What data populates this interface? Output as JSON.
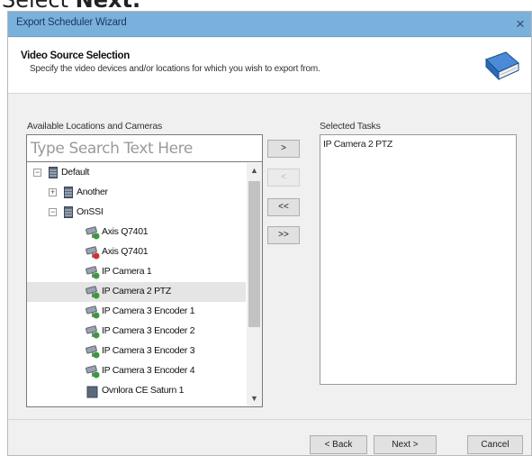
{
  "caption": {
    "prefix": "Select ",
    "bold": "Next."
  },
  "window": {
    "title": "Export Scheduler Wizard",
    "close_glyph": "×"
  },
  "header": {
    "title": "Video Source Selection",
    "subtitle": "Specify the video devices and/or locations for which you wish to export from.",
    "icon": "book-icon"
  },
  "left": {
    "label": "Available Locations and Cameras",
    "search_placeholder": "Type Search Text Here"
  },
  "tree": [
    {
      "label": "Default",
      "type": "group",
      "expander": "−",
      "level": 0
    },
    {
      "label": "Another",
      "type": "group",
      "expander": "+",
      "level": 1
    },
    {
      "label": "OnSSI",
      "type": "group",
      "expander": "−",
      "level": 1
    },
    {
      "label": "Axis Q7401",
      "type": "camera",
      "level": 2
    },
    {
      "label": "Axis Q7401",
      "type": "camera-offline",
      "level": 2
    },
    {
      "label": "IP Camera 1",
      "type": "camera",
      "level": 2
    },
    {
      "label": "IP Camera 2 PTZ",
      "type": "camera",
      "level": 2,
      "selected": true
    },
    {
      "label": "IP Camera 3 Encoder 1",
      "type": "camera",
      "level": 2
    },
    {
      "label": "IP Camera 3 Encoder 2",
      "type": "camera",
      "level": 2
    },
    {
      "label": "IP Camera 3 Encoder 3",
      "type": "camera",
      "level": 2
    },
    {
      "label": "IP Camera 3 Encoder 4",
      "type": "camera",
      "level": 2
    },
    {
      "label": "Ovnlora CE Saturn 1",
      "type": "device",
      "level": 2
    }
  ],
  "scrollbar": {
    "up": "▲",
    "down": "▼"
  },
  "transfer": {
    "add": ">",
    "remove": "<",
    "remove_all": "<<",
    "add_all": ">>"
  },
  "right": {
    "label": "Selected Tasks",
    "items": [
      "IP Camera 2 PTZ"
    ]
  },
  "footer": {
    "back": "< Back",
    "next": "Next >",
    "cancel": "Cancel"
  },
  "colors": {
    "titlebar": "#7ab1dc",
    "camera_green": "#3a9a3a",
    "offline_red": "#d03030",
    "book_blue": "#2a6bb8"
  }
}
